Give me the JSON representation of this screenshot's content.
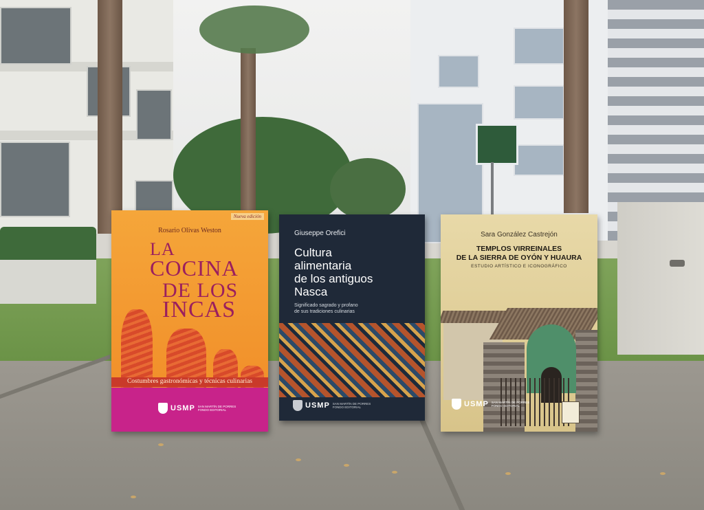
{
  "books": [
    {
      "edition": "Nueva edición",
      "author": "Rosario Olivas Weston",
      "title_lines": [
        "LA",
        "COCINA",
        "DE LOS",
        "INCAS"
      ],
      "subtitle": "Costumbres gastronómicas y técnicas culinarias",
      "publisher": {
        "name": "USMP",
        "line1": "SAN MARTÍN DE PORRES",
        "line2": "FONDO EDITORIAL"
      },
      "colors": {
        "cover": "#f08a26",
        "title": "#9b1f5e",
        "band": "#c8238a"
      }
    },
    {
      "author": "Giuseppe Orefici",
      "title_lines": [
        "Cultura",
        "alimentaria",
        "de los antiguos",
        "Nasca"
      ],
      "subtitle_lines": [
        "Significado sagrado y profano",
        "de sus tradiciones culinarias"
      ],
      "publisher": {
        "name": "USMP",
        "line1": "SAN MARTÍN DE PORRES",
        "line2": "FONDO EDITORIAL"
      },
      "colors": {
        "cover": "#1f2938"
      }
    },
    {
      "author": "Sara González Castrejón",
      "title_lines": [
        "TEMPLOS VIRREINALES",
        "DE LA SIERRA DE OYÓN Y HUAURA"
      ],
      "subtitle": "ESTUDIO ARTÍSTICO E ICONOGRÁFICO",
      "publisher": {
        "name": "USMP",
        "line1": "SAN MARTÍN DE PORRES",
        "line2": "FONDO EDITORIAL"
      },
      "colors": {
        "cover": "#d8c48a",
        "chapel": "#4f8f6a"
      }
    }
  ]
}
